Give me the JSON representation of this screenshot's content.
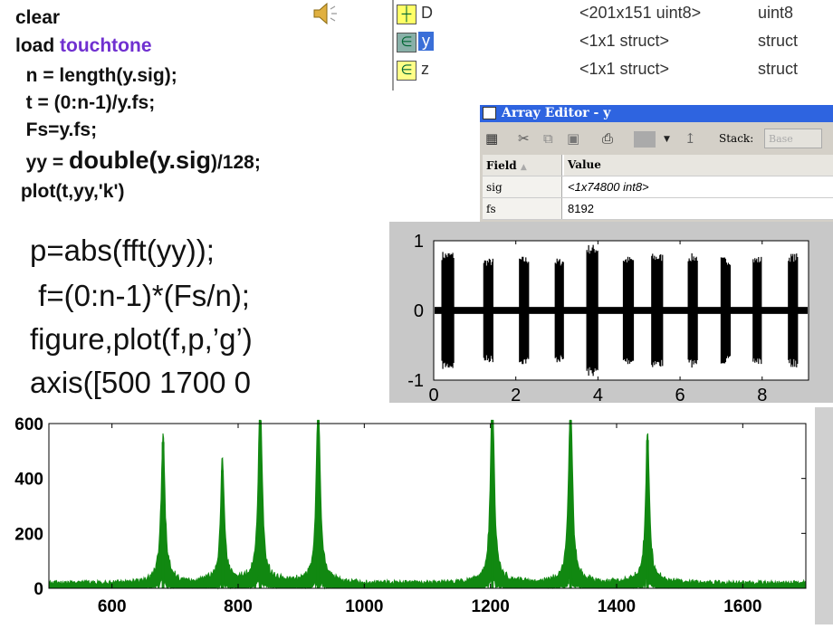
{
  "slide": {
    "code_block_1": [
      {
        "text": "clear"
      },
      {
        "prefix": "load ",
        "keyword": "touchtone"
      },
      {
        "text": "  n = length(y.sig);"
      },
      {
        "text": "  t = (0:n-1)/y.fs;"
      },
      {
        "text": "  Fs=y.fs;"
      },
      {
        "prefix": "  yy = ",
        "big": "double(y.sig",
        "suffix": ")/128;"
      },
      {
        "text": " plot(t,yy,'k')"
      }
    ],
    "code_block_2": [
      "p=abs(fft(yy));",
      " f=(0:n-1)*(Fs/n);",
      "figure,plot(f,p,’g’)",
      "axis([500 1700 0"
    ],
    "speaker_icon": "speaker-icon",
    "keyword_color": "#7030d0"
  },
  "workspace": {
    "rows": [
      {
        "icon": "matrix-icon",
        "name": "D",
        "value": "<201x151 uint8>",
        "class": "uint8",
        "selected": false
      },
      {
        "icon": "struct-icon",
        "name": "y",
        "value": "<1x1 struct>",
        "class": "struct",
        "selected": true
      },
      {
        "icon": "struct-icon",
        "name": "z",
        "value": "<1x1 struct>",
        "class": "struct",
        "selected": false
      }
    ]
  },
  "array_editor": {
    "title": "Array Editor - y",
    "stack_label": "Stack:",
    "stack_value": "Base",
    "columns": [
      "Field",
      "Value"
    ],
    "rows": [
      {
        "field": "sig",
        "value": "<1x74800 int8>"
      },
      {
        "field": "fs",
        "value": "8192"
      }
    ],
    "title_color": "#2e64e0"
  },
  "chart_data": [
    {
      "type": "line",
      "color": "#000000",
      "xlim": [
        0,
        9.13
      ],
      "ylim": [
        -1,
        1
      ],
      "xticks": [
        "0",
        "2",
        "4",
        "6",
        "8"
      ],
      "yticks": [
        "-1",
        "0",
        "1"
      ],
      "grid": false,
      "bursts": [
        {
          "start": 0.2,
          "end": 0.5,
          "amp": 0.85
        },
        {
          "start": 1.22,
          "end": 1.46,
          "amp": 0.75
        },
        {
          "start": 2.09,
          "end": 2.33,
          "amp": 0.78
        },
        {
          "start": 2.96,
          "end": 3.18,
          "amp": 0.75
        },
        {
          "start": 3.73,
          "end": 4.0,
          "amp": 0.95
        },
        {
          "start": 4.62,
          "end": 4.87,
          "amp": 0.78
        },
        {
          "start": 5.31,
          "end": 5.58,
          "amp": 0.82
        },
        {
          "start": 6.2,
          "end": 6.44,
          "amp": 0.82
        },
        {
          "start": 7.0,
          "end": 7.24,
          "amp": 0.77
        },
        {
          "start": 7.78,
          "end": 8.0,
          "amp": 0.78
        },
        {
          "start": 8.64,
          "end": 8.87,
          "amp": 0.82
        }
      ],
      "noise_level": 0.05
    },
    {
      "type": "line",
      "color": "#118811",
      "xlim": [
        500,
        1700
      ],
      "ylim": [
        0,
        600
      ],
      "xticks": [
        "600",
        "800",
        "1000",
        "1200",
        "1400",
        "1600"
      ],
      "yticks": [
        "0",
        "200",
        "400",
        "600"
      ],
      "grid": false,
      "peaks": [
        {
          "f": 681,
          "p": 533
        },
        {
          "f": 775,
          "p": 430
        },
        {
          "f": 835,
          "p": 700
        },
        {
          "f": 927,
          "p": 700
        },
        {
          "f": 1203,
          "p": 700
        },
        {
          "f": 1327,
          "p": 700
        },
        {
          "f": 1449,
          "p": 540
        }
      ],
      "noise_floor": 20
    }
  ]
}
